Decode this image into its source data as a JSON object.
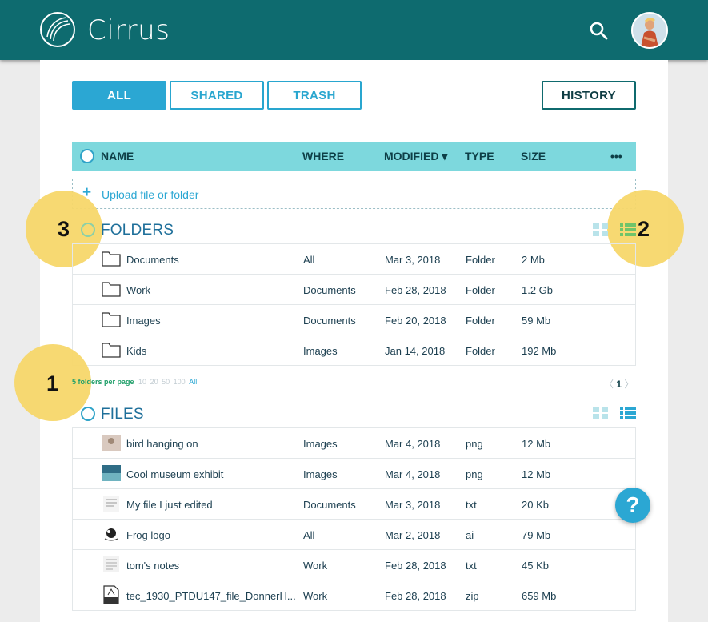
{
  "app": {
    "title": "Cirrus"
  },
  "tabs": [
    {
      "label": "ALL",
      "active": true
    },
    {
      "label": "SHARED",
      "active": false
    },
    {
      "label": "TRASH",
      "active": false
    }
  ],
  "history_label": "HISTORY",
  "columns": {
    "name": "NAME",
    "where": "WHERE",
    "modified": "MODIFIED ▾",
    "type": "TYPE",
    "size": "SIZE",
    "more": "•••"
  },
  "upload": {
    "icon": "+",
    "label": "Upload file or folder"
  },
  "folders": {
    "title": "FOLDERS",
    "rows": [
      {
        "name": "Documents",
        "where": "All",
        "modified": "Mar 3, 2018",
        "type": "Folder",
        "size": "2 Mb"
      },
      {
        "name": "Work",
        "where": "Documents",
        "modified": "Feb 28, 2018",
        "type": "Folder",
        "size": "1.2 Gb"
      },
      {
        "name": "Images",
        "where": "Documents",
        "modified": "Feb 20, 2018",
        "type": "Folder",
        "size": "59 Mb"
      },
      {
        "name": "Kids",
        "where": "Images",
        "modified": "Jan 14, 2018",
        "type": "Folder",
        "size": "192 Mb"
      }
    ]
  },
  "pagination": {
    "per_page_label": "5 folders per page",
    "options": [
      "10",
      "20",
      "50",
      "100"
    ],
    "all": "All",
    "prev": "〈",
    "page": "1",
    "next": "〉"
  },
  "files": {
    "title": "FILES",
    "rows": [
      {
        "name": "bird hanging on",
        "where": "Images",
        "modified": "Mar 4, 2018",
        "type": "png",
        "size": "12 Mb"
      },
      {
        "name": "Cool museum exhibit",
        "where": "Images",
        "modified": "Mar 4, 2018",
        "type": "png",
        "size": "12 Mb"
      },
      {
        "name": "My file I just edited",
        "where": "Documents",
        "modified": "Mar 3, 2018",
        "type": "txt",
        "size": "20 Kb"
      },
      {
        "name": "Frog logo",
        "where": "All",
        "modified": "Mar 2, 2018",
        "type": "ai",
        "size": "79 Mb"
      },
      {
        "name": "tom's notes",
        "where": "Work",
        "modified": "Feb 28, 2018",
        "type": "txt",
        "size": "45 Kb"
      },
      {
        "name": "tec_1930_PTDU147_file_DonnerH...",
        "where": "Work",
        "modified": "Feb 28, 2018",
        "type": "zip",
        "size": "659 Mb"
      }
    ]
  },
  "badges": [
    "1",
    "2",
    "3"
  ],
  "help_label": "?",
  "colors": {
    "header": "#0e6b6f",
    "accent": "#2ba7d3",
    "table_header": "#7dd8dd",
    "badge": "#f7d76a"
  }
}
